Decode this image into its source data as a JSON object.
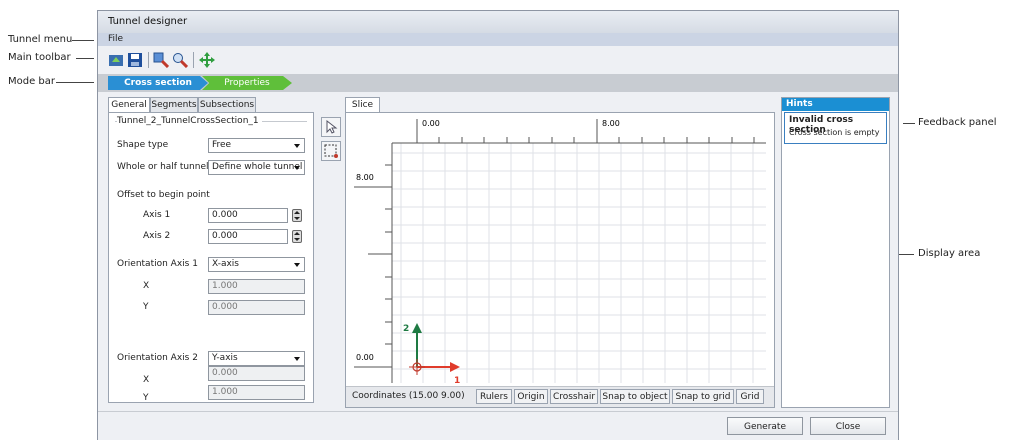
{
  "callouts": {
    "tunnel_menu": "Tunnel menu",
    "main_toolbar": "Main toolbar",
    "mode_bar": "Mode bar",
    "feedback_panel": "Feedback panel",
    "display_area": "Display area"
  },
  "window": {
    "title": "Tunnel designer"
  },
  "menu": {
    "file": "File"
  },
  "toolbar": {
    "icons": [
      "import-icon",
      "save-icon",
      "zoom-in-icon",
      "zoom-out-icon",
      "pan-icon"
    ]
  },
  "modes": {
    "cross_section": "Cross section",
    "properties": "Properties"
  },
  "tabs": {
    "general": "General",
    "segments": "Segments",
    "subsections": "Subsections"
  },
  "form": {
    "group_title": "Tunnel_2_TunnelCrossSection_1",
    "shape_type_label": "Shape type",
    "shape_type_value": "Free",
    "whole_half_label": "Whole or half tunnel",
    "whole_half_value": "Define whole tunnel",
    "offset_label": "Offset to begin point",
    "axis1_label": "Axis 1",
    "axis1_value": "0.000",
    "axis2_label": "Axis 2",
    "axis2_value": "0.000",
    "orient1_label": "Orientation Axis 1",
    "orient1_value": "X-axis",
    "o1x_label": "X",
    "o1x_value": "1.000",
    "o1y_label": "Y",
    "o1y_value": "0.000",
    "orient2_label": "Orientation Axis 2",
    "orient2_value": "Y-axis",
    "o2x_label": "X",
    "o2x_value": "0.000",
    "o2y_label": "Y",
    "o2y_value": "1.000"
  },
  "display": {
    "tab": "Slice",
    "ruler_top_1": "0.00",
    "ruler_top_2": "8.00",
    "ruler_left_1": "8.00",
    "ruler_left_2": "0.00",
    "axis_label_2": "2",
    "axis_label_1": "1",
    "coordinates": "Coordinates  (15.00 9.00)",
    "buttons": [
      "Rulers",
      "Origin",
      "Crosshair",
      "Snap to object",
      "Snap to grid",
      "Grid"
    ]
  },
  "hints": {
    "title": "Hints",
    "message_title": "Invalid cross section",
    "message_body": "Cross section is empty"
  },
  "footer": {
    "generate": "Generate",
    "close": "Close"
  },
  "colors": {
    "accent_blue": "#2a8fd4",
    "mode_green": "#5fbf3a",
    "axis_red": "#e03b2b",
    "axis_green": "#1e7a43"
  }
}
